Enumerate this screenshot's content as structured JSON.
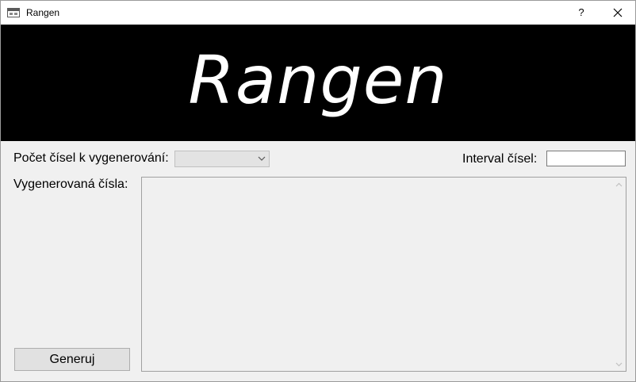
{
  "window": {
    "title": "Rangen",
    "help_label": "?"
  },
  "banner": {
    "title": "Rangen"
  },
  "form": {
    "count_label": "Počet čísel k vygenerování:",
    "count_value": "",
    "interval_label": "Interval čísel:",
    "interval_value": "",
    "generated_label": "Vygenerovaná čísla:",
    "generated_output": "",
    "generate_button": "Generuj"
  }
}
